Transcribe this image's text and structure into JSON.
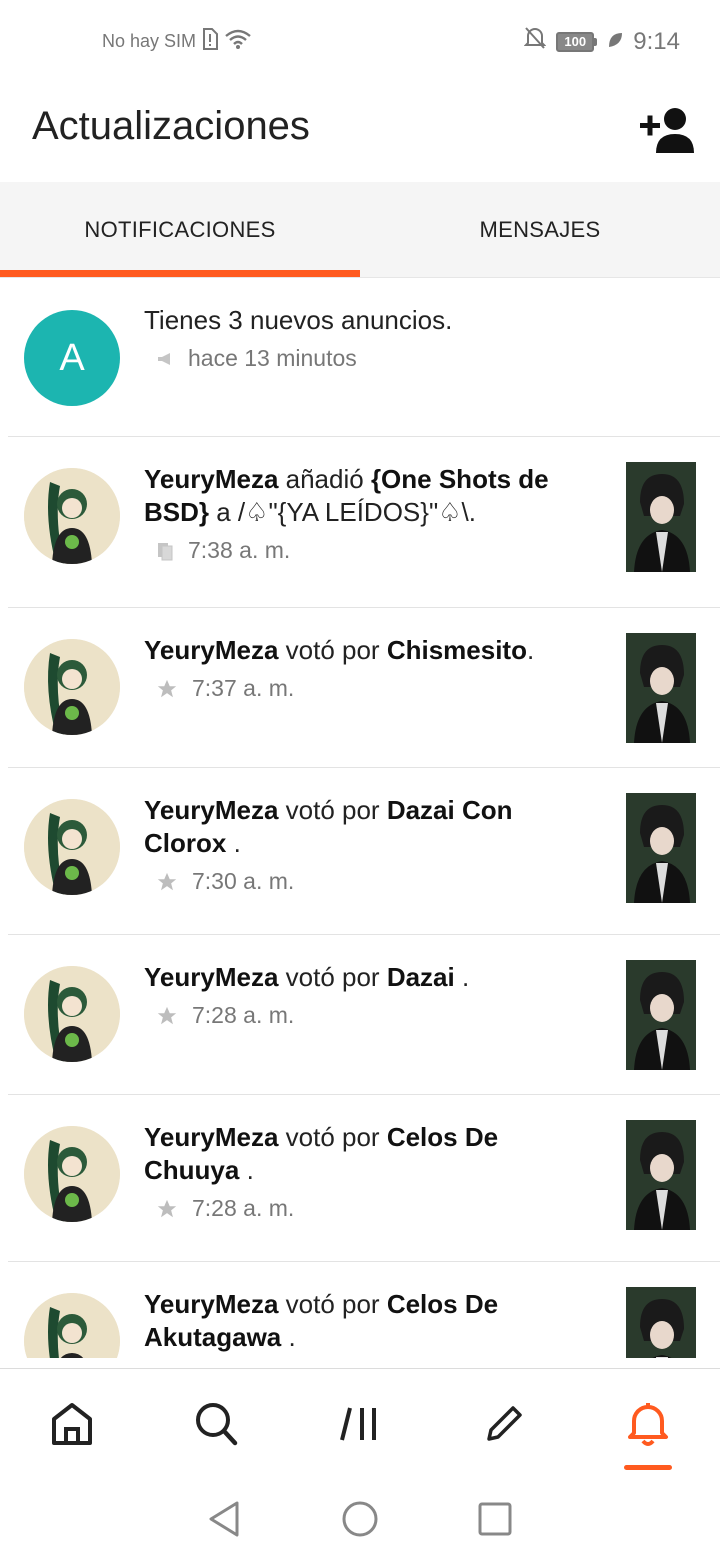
{
  "status_bar": {
    "carrier": "No hay SIM",
    "battery": "100",
    "time": "9:14"
  },
  "header": {
    "title": "Actualizaciones",
    "add_user_icon": "add-person-icon"
  },
  "tabs": [
    {
      "label": "NOTIFICACIONES",
      "active": true
    },
    {
      "label": "MENSAJES",
      "active": false
    }
  ],
  "announcement": {
    "avatar_letter": "A",
    "text": "Tienes 3 nuevos anuncios.",
    "time": "hace 13 minutos",
    "icon": "megaphone-icon"
  },
  "notifications": [
    {
      "user": "YeuryMeza",
      "action": " añadió ",
      "target": "{One Shots de BSD}",
      "suffix": " a /♤\"{YA LEÍDOS}\"♤\\.",
      "time": "7:38 a. m.",
      "icon": "library-icon"
    },
    {
      "user": "YeuryMeza",
      "action": " votó por ",
      "target": "Chismesito",
      "suffix": ".",
      "time": "7:37 a. m.",
      "icon": "star-icon"
    },
    {
      "user": "YeuryMeza",
      "action": " votó por ",
      "target": "Dazai Con Clorox",
      "suffix": " .",
      "time": "7:30 a. m.",
      "icon": "star-icon"
    },
    {
      "user": "YeuryMeza",
      "action": " votó por ",
      "target": "Dazai",
      "suffix": " .",
      "time": "7:28 a. m.",
      "icon": "star-icon"
    },
    {
      "user": "YeuryMeza",
      "action": " votó por ",
      "target": "Celos De Chuuya",
      "suffix": " .",
      "time": "7:28 a. m.",
      "icon": "star-icon"
    },
    {
      "user": "YeuryMeza",
      "action": " votó por ",
      "target": "Celos De Akutagawa",
      "suffix": " .",
      "time": "",
      "icon": "star-icon"
    }
  ],
  "bottom_nav": [
    {
      "name": "home",
      "icon": "home-icon"
    },
    {
      "name": "search",
      "icon": "search-icon"
    },
    {
      "name": "library",
      "icon": "library-icon"
    },
    {
      "name": "write",
      "icon": "pencil-icon"
    },
    {
      "name": "notifications",
      "icon": "bell-icon",
      "active": true
    }
  ],
  "colors": {
    "accent": "#ff5a1f",
    "avatar_teal": "#1cb5b0"
  }
}
